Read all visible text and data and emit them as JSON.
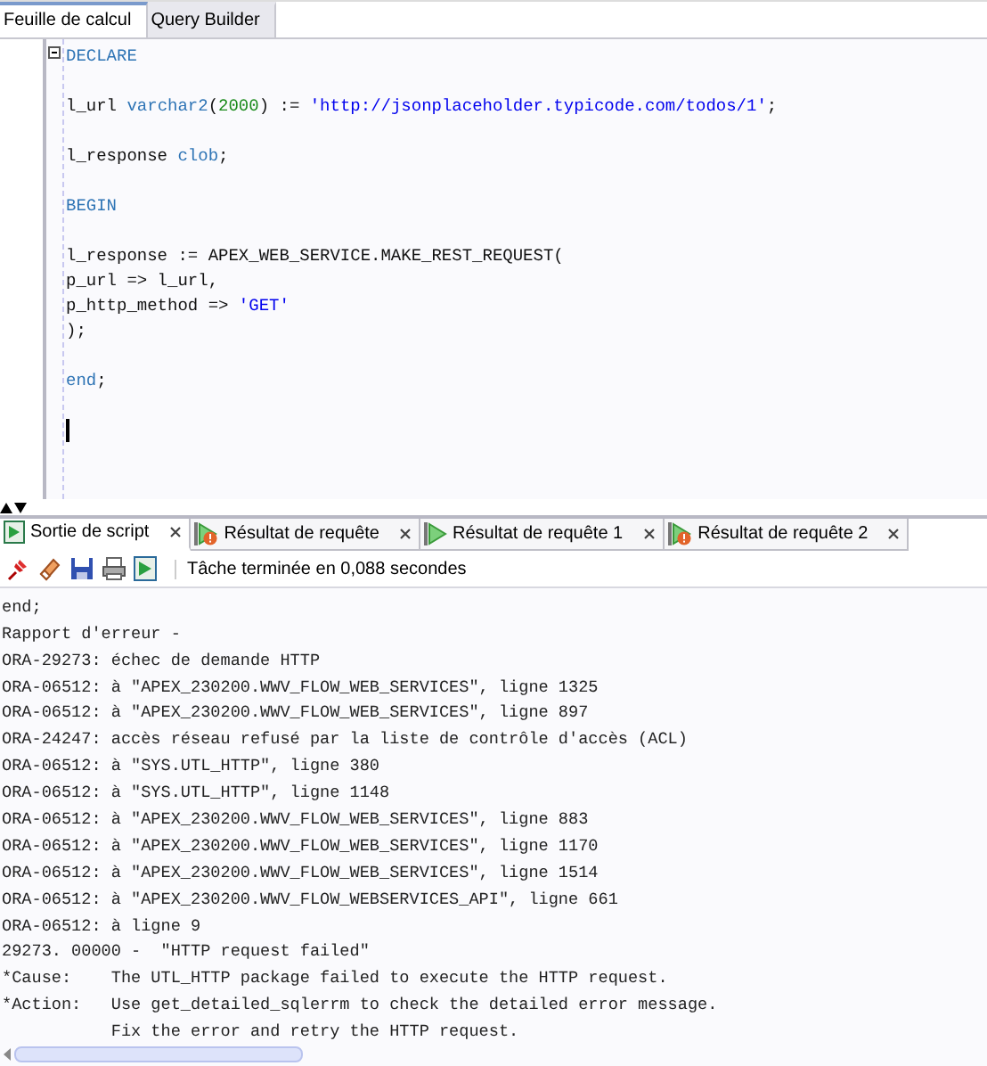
{
  "editor_tabs": [
    {
      "label": "Feuille de calcul",
      "selected": true
    },
    {
      "label": "Query Builder",
      "selected": false
    }
  ],
  "code_lines": [
    {
      "kind": "code",
      "tokens": [
        {
          "kind": "keyword",
          "text": "DECLARE"
        }
      ]
    },
    {
      "kind": "blank"
    },
    {
      "kind": "code",
      "tokens": [
        {
          "kind": "plain",
          "text": "l_url "
        },
        {
          "kind": "keyword",
          "text": "varchar2"
        },
        {
          "kind": "plain",
          "text": "("
        },
        {
          "kind": "number",
          "text": "2000"
        },
        {
          "kind": "plain",
          "text": ") := "
        },
        {
          "kind": "string",
          "text": "'http://jsonplaceholder.typicode.com/todos/1'"
        },
        {
          "kind": "plain",
          "text": ";"
        }
      ]
    },
    {
      "kind": "blank"
    },
    {
      "kind": "code",
      "tokens": [
        {
          "kind": "plain",
          "text": "l_response "
        },
        {
          "kind": "keyword",
          "text": "clob"
        },
        {
          "kind": "plain",
          "text": ";"
        }
      ]
    },
    {
      "kind": "blank"
    },
    {
      "kind": "code",
      "tokens": [
        {
          "kind": "keyword",
          "text": "BEGIN"
        }
      ]
    },
    {
      "kind": "blank"
    },
    {
      "kind": "code",
      "tokens": [
        {
          "kind": "plain",
          "text": "l_response := APEX_WEB_SERVICE.MAKE_REST_REQUEST("
        }
      ]
    },
    {
      "kind": "code",
      "tokens": [
        {
          "kind": "plain",
          "text": "p_url => l_url,"
        }
      ]
    },
    {
      "kind": "code",
      "tokens": [
        {
          "kind": "plain",
          "text": "p_http_method => "
        },
        {
          "kind": "string",
          "text": "'GET'"
        }
      ]
    },
    {
      "kind": "code",
      "tokens": [
        {
          "kind": "plain",
          "text": ");"
        }
      ]
    },
    {
      "kind": "blank"
    },
    {
      "kind": "code",
      "tokens": [
        {
          "kind": "keyword",
          "text": "end"
        },
        {
          "kind": "plain",
          "text": ";"
        }
      ]
    },
    {
      "kind": "blank"
    },
    {
      "kind": "caret"
    }
  ],
  "output_tabs": [
    {
      "label": "Sortie de script",
      "kind": "script",
      "selected": true
    },
    {
      "label": "Résultat de requête",
      "kind": "warning",
      "selected": false
    },
    {
      "label": "Résultat de requête 1",
      "kind": "run",
      "selected": false
    },
    {
      "label": "Résultat de requête 2",
      "kind": "warning",
      "selected": false
    }
  ],
  "toolbar": {
    "status": "Tâche terminée en 0,088 secondes"
  },
  "output_lines": [
    "end;",
    "Rapport d'erreur -",
    "ORA-29273: échec de demande HTTP",
    "ORA-06512: à \"APEX_230200.WWV_FLOW_WEB_SERVICES\", ligne 1325",
    "ORA-06512: à \"APEX_230200.WWV_FLOW_WEB_SERVICES\", ligne 897",
    "ORA-24247: accès réseau refusé par la liste de contrôle d'accès (ACL)",
    "ORA-06512: à \"SYS.UTL_HTTP\", ligne 380",
    "ORA-06512: à \"SYS.UTL_HTTP\", ligne 1148",
    "ORA-06512: à \"APEX_230200.WWV_FLOW_WEB_SERVICES\", ligne 883",
    "ORA-06512: à \"APEX_230200.WWV_FLOW_WEB_SERVICES\", ligne 1170",
    "ORA-06512: à \"APEX_230200.WWV_FLOW_WEB_SERVICES\", ligne 1514",
    "ORA-06512: à \"APEX_230200.WWV_FLOW_WEBSERVICES_API\", ligne 661",
    "ORA-06512: à ligne 9",
    "29273. 00000 -  \"HTTP request failed\"",
    "*Cause:    The UTL_HTTP package failed to execute the HTTP request.",
    "*Action:   Use get_detailed_sqlerrm to check the detailed error message.",
    "           Fix the error and retry the HTTP request."
  ]
}
